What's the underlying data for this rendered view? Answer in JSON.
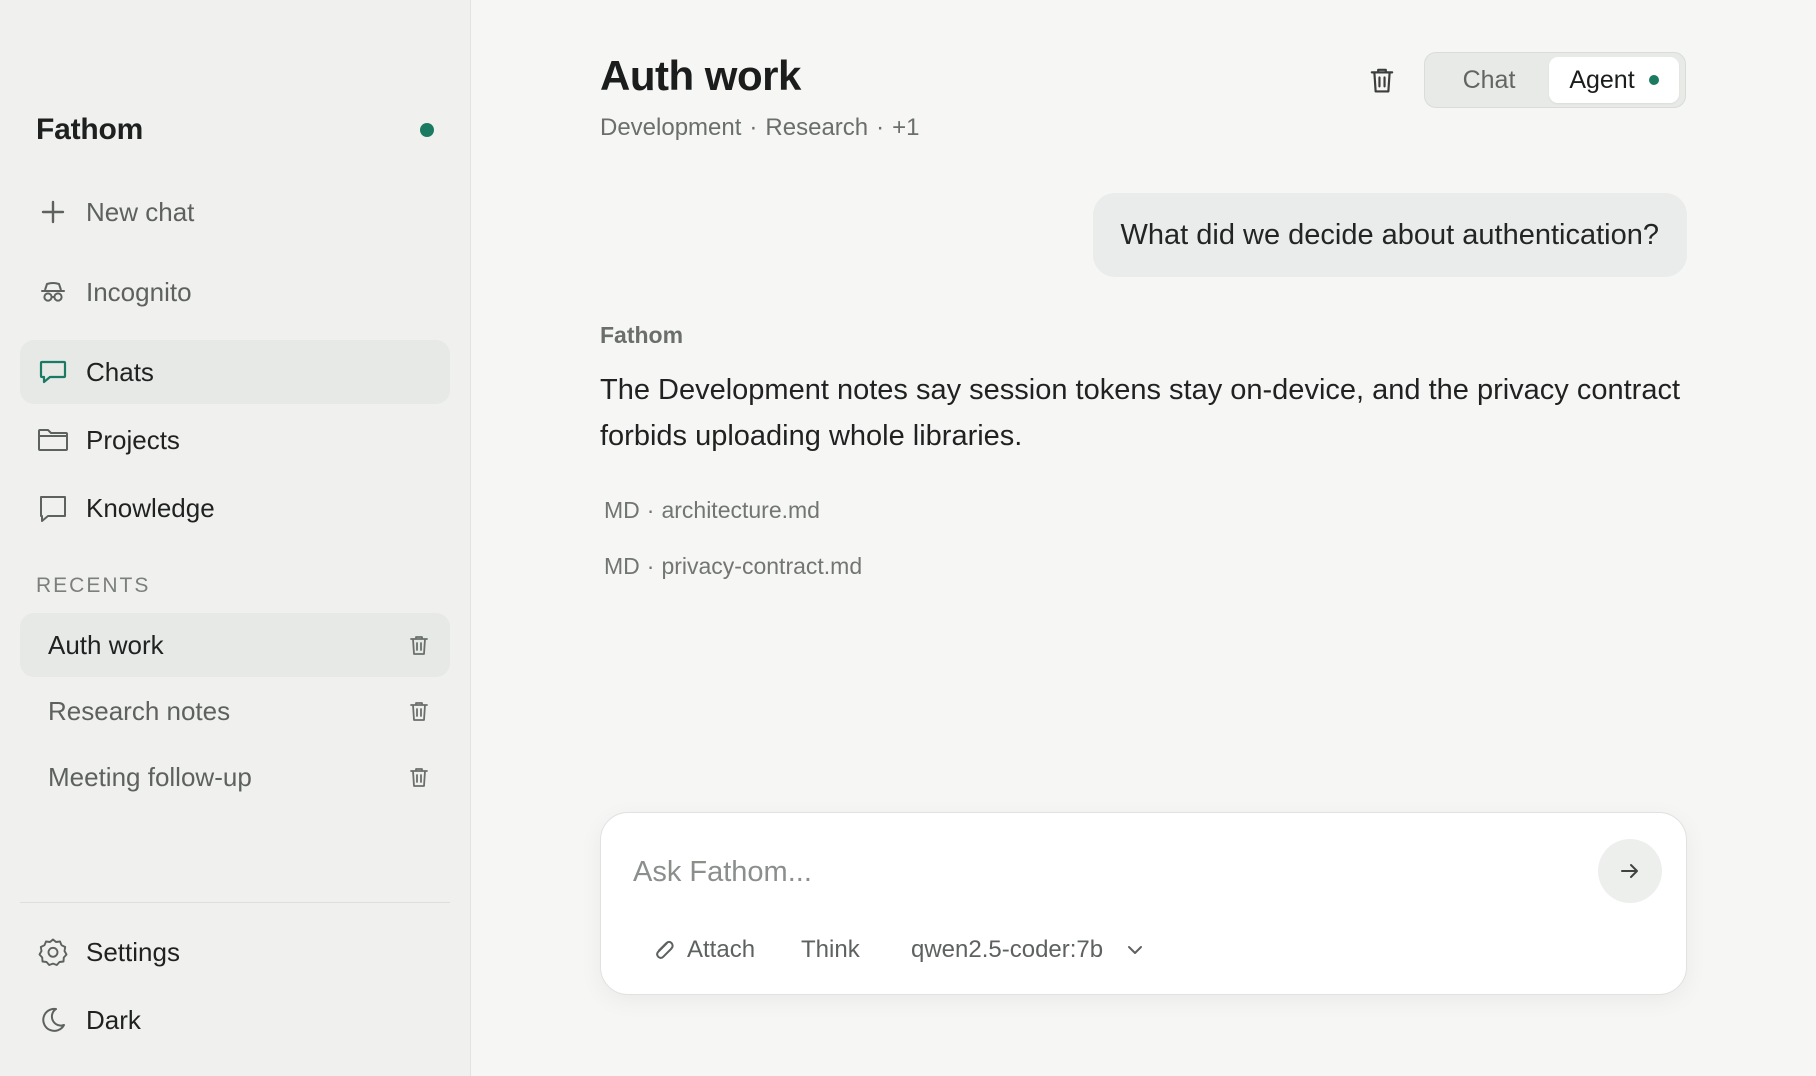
{
  "sidebar": {
    "brand": "Fathom",
    "status_color": "#1a7a62",
    "nav": {
      "new_chat": "New chat",
      "incognito": "Incognito",
      "chats": "Chats",
      "projects": "Projects",
      "knowledge": "Knowledge"
    },
    "recents_label": "RECENTS",
    "recents": [
      {
        "label": "Auth work",
        "active": true
      },
      {
        "label": "Research notes",
        "active": false
      },
      {
        "label": "Meeting follow-up",
        "active": false
      }
    ],
    "footer": {
      "settings": "Settings",
      "theme": "Dark"
    }
  },
  "header": {
    "title": "Auth work",
    "tags": [
      "Development",
      "Research",
      "+1"
    ],
    "tag_separator": "·",
    "mode": {
      "chat": "Chat",
      "agent": "Agent",
      "selected": "Agent"
    }
  },
  "conversation": {
    "user_message": "What did we decide about authentication?",
    "assistant_name": "Fathom",
    "assistant_message": "The Development notes say session tokens stay on-device, and the privacy contract forbids uploading whole libraries.",
    "sources": [
      {
        "type": "MD",
        "name": "architecture.md"
      },
      {
        "type": "MD",
        "name": "privacy-contract.md"
      }
    ]
  },
  "composer": {
    "placeholder": "Ask Fathom...",
    "value": "",
    "attach": "Attach",
    "think": "Think",
    "model": "qwen2.5-coder:7b"
  },
  "colors": {
    "accent": "#1a7a62",
    "background": "#f6f6f5",
    "sidebar": "#f0f1ef"
  }
}
